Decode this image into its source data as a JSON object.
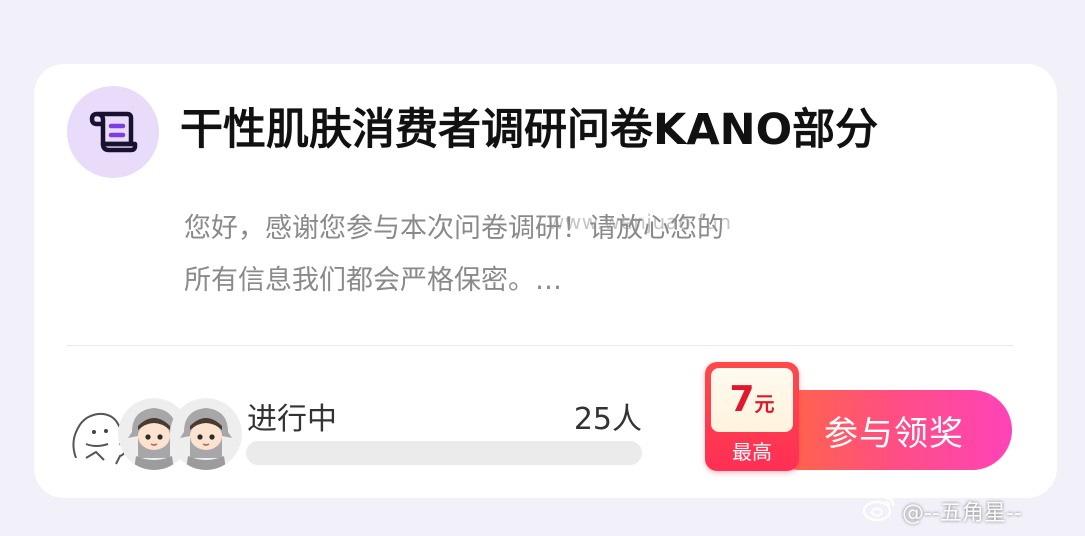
{
  "survey": {
    "title": "干性肌肤消费者调研问卷KANO部分",
    "description": "您好，感谢您参与本次问卷调研！请放心您的所有信息我们都会严格保密。…",
    "status": "进行中",
    "participants": "25人",
    "progress_fraction": 0.0
  },
  "reward": {
    "amount": "7",
    "unit": "元",
    "caption": "最高"
  },
  "actions": {
    "join_label": "参与领奖"
  },
  "watermarks": {
    "top": "www.wenjuao.fun",
    "bottom": "@--五角星--"
  },
  "icons": {
    "survey": "scroll-document-icon",
    "weibo": "weibo-icon"
  },
  "colors": {
    "background": "#f2f0f8",
    "card": "#ffffff",
    "icon_circle": "#e9dcfb",
    "icon_stroke": "#1a1030",
    "button_start": "#ff6a3a",
    "button_end": "#ff43b8",
    "reward_red": "#e0182e"
  }
}
